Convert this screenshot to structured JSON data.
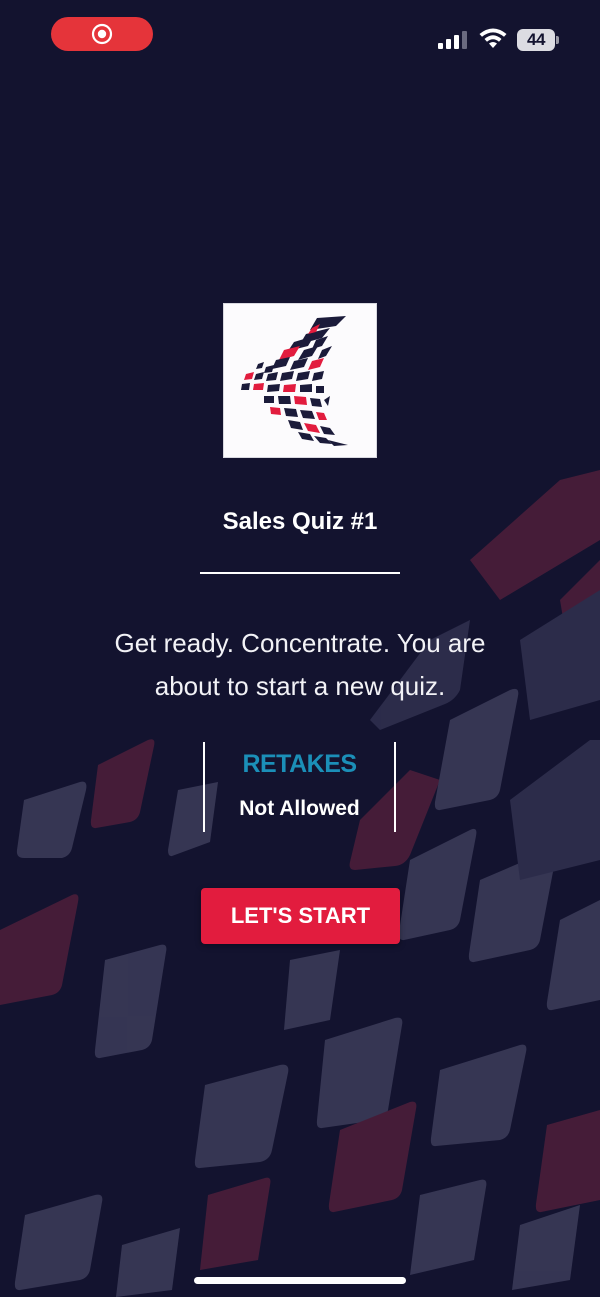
{
  "status_bar": {
    "battery_level": "44",
    "record_icon": "screen-record-icon",
    "signal_icon": "cellular-signal-icon",
    "wifi_icon": "wifi-icon",
    "record_color": "#e5343a"
  },
  "quiz": {
    "logo_icon": "company-logo",
    "title": "Sales Quiz #1",
    "intro_line1": "Get ready. Concentrate. You are",
    "intro_line2": "about to start a new quiz.",
    "retakes_label": "RETAKES",
    "retakes_value": "Not Allowed",
    "start_label": "LET'S START"
  },
  "theme": {
    "background": "#13132f",
    "accent": "#e21c3e",
    "retakes_color": "#1b8fb8"
  }
}
